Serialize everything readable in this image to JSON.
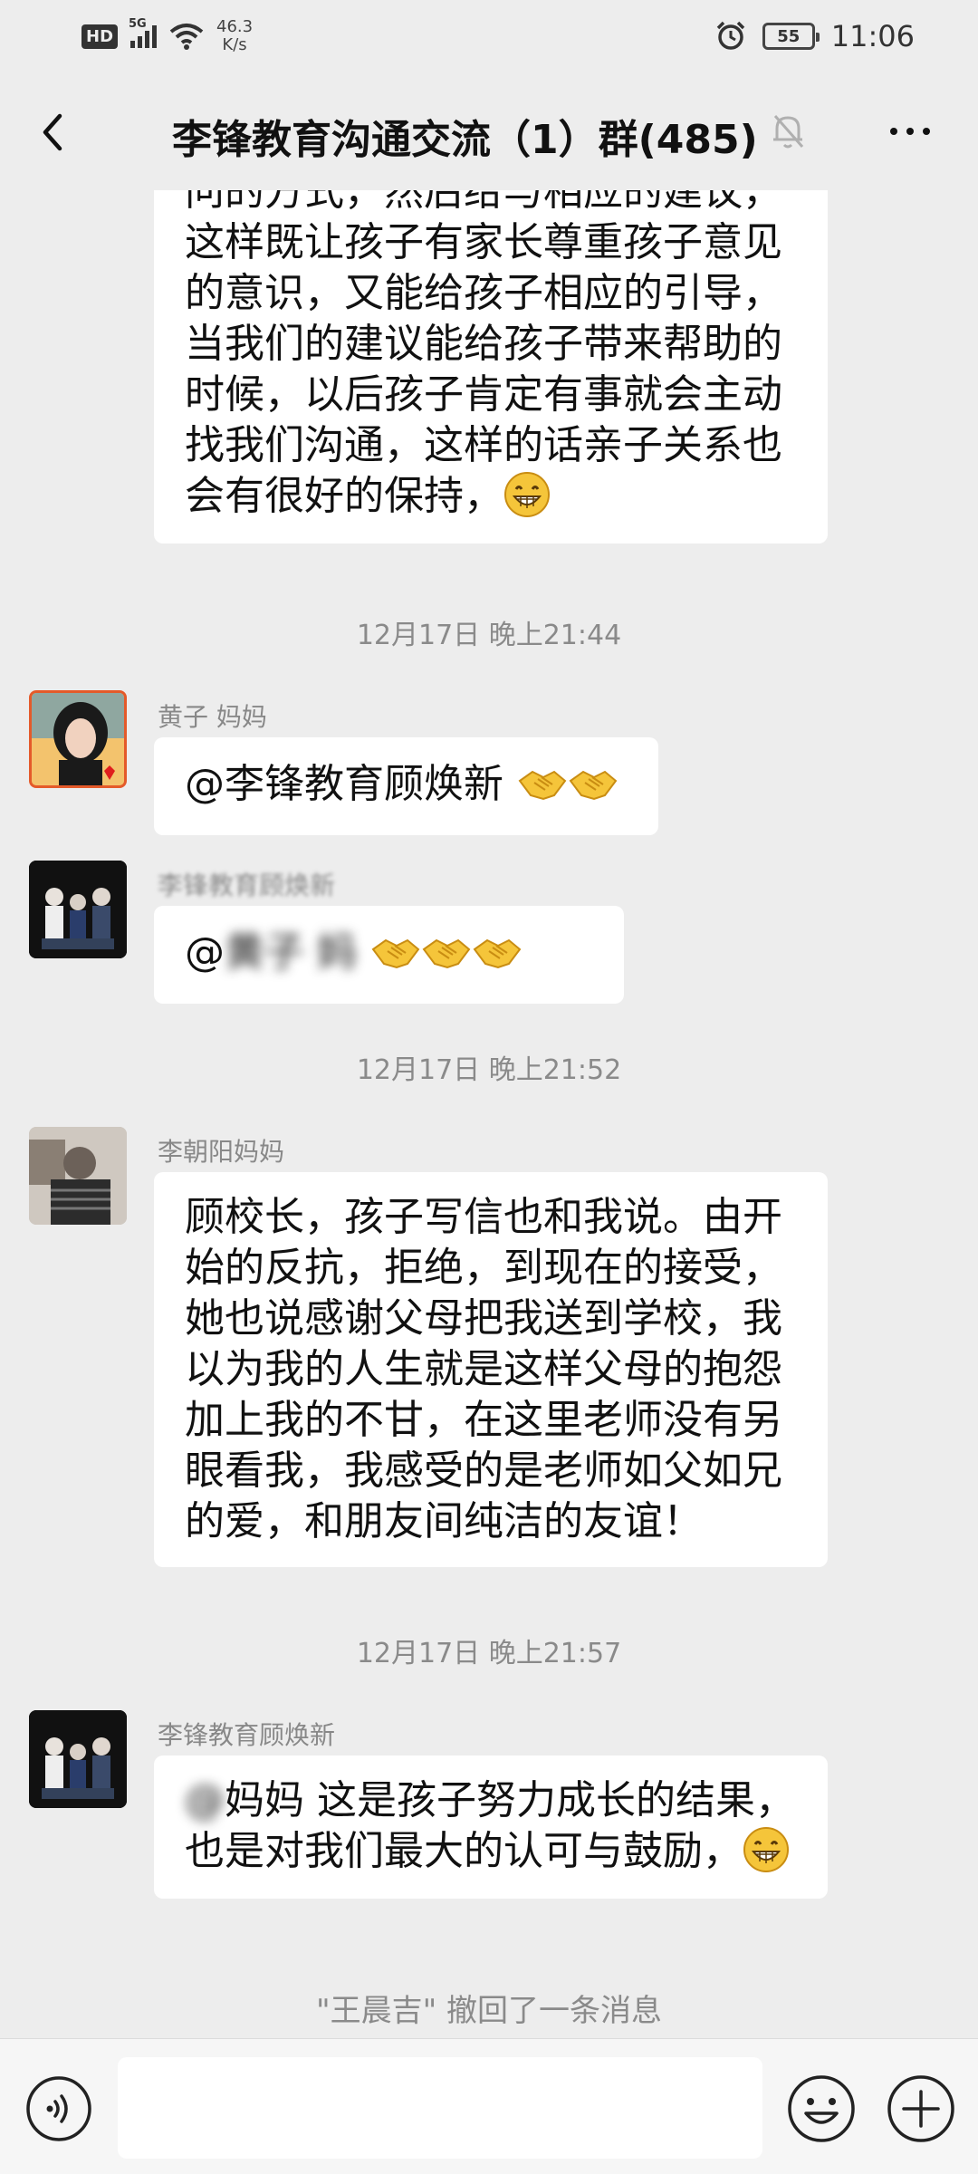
{
  "status_bar": {
    "hd": "HD",
    "network": "5G",
    "speed_value": "46.3",
    "speed_unit": "K/s",
    "battery": "55",
    "time": "11:06"
  },
  "header": {
    "title": "李锋教育沟通交流（1）群(485)"
  },
  "messages": [
    {
      "text": "问的方式，然后给与相应的建议，这样既让孩子有家长尊重孩子意见的意识，又能给孩子相应的引导，当我们的建议能给孩子带来帮助的时候，以后孩子肯定有事就会主动找我们沟通，这样的话亲子关系也会有很好的保持，"
    },
    {
      "timestamp": "12月17日 晚上21:44"
    },
    {
      "sender": "黄子 妈妈",
      "text": "@李锋教育顾焕新"
    },
    {
      "sender": "李锋教育顾焕新",
      "text_visible": "@",
      "text_blurred": "黄子 妈"
    },
    {
      "timestamp": "12月17日 晚上21:52"
    },
    {
      "sender": "李朝阳妈妈",
      "text": "顾校长，孩子写信也和我说。由开始的反抗，拒绝，到现在的接受，她也说感谢父母把我送到学校，我以为我的人生就是这样父母的抱怨加上我的不甘，在这里老师没有另眼看我，我感受的是老师如父如兄的爱，和朋友间纯洁的友谊！"
    },
    {
      "timestamp": "12月17日 晚上21:57"
    },
    {
      "sender": "李锋教育顾焕新",
      "text_blurred": "@",
      "text_visible": "妈妈  这是孩子努力成长的结果，也是对我们最大的认可与鼓励，"
    }
  ],
  "recall_notice": "\"王晨吉\" 撤回了一条消息",
  "colors": {
    "background": "#ededed",
    "bubble": "#ffffff",
    "meta_text": "#8a8a8a",
    "emoji_yellow": "#f5c53a"
  },
  "icons": [
    "back-arrow-icon",
    "muted-bell-icon",
    "more-icon",
    "grin-emoji-icon",
    "handshake-emoji-icon",
    "voice-icon",
    "emoji-icon",
    "plus-icon"
  ]
}
